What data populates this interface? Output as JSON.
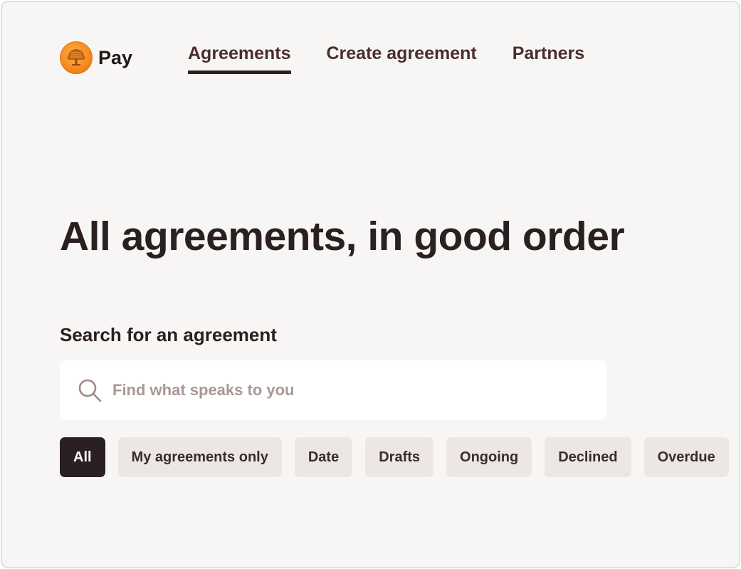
{
  "brand": {
    "name": "Pay",
    "logo_icon": "oak-tree-logo",
    "logo_color": "#f58a1f"
  },
  "nav": {
    "items": [
      {
        "label": "Agreements",
        "active": true
      },
      {
        "label": "Create agreement",
        "active": false
      },
      {
        "label": "Partners",
        "active": false
      }
    ]
  },
  "main": {
    "headline": "All agreements, in good order"
  },
  "search": {
    "label": "Search for an agreement",
    "placeholder": "Find what speaks to you",
    "value": "",
    "icon": "search-icon"
  },
  "filters": {
    "chips": [
      {
        "label": "All",
        "active": true
      },
      {
        "label": "My agreements only",
        "active": false
      },
      {
        "label": "Date",
        "active": false
      },
      {
        "label": "Drafts",
        "active": false
      },
      {
        "label": "Ongoing",
        "active": false
      },
      {
        "label": "Declined",
        "active": false
      },
      {
        "label": "Overdue",
        "active": false
      }
    ]
  },
  "colors": {
    "text": "#2b2021",
    "background": "#f8f6f4",
    "chip": "#ece7e3",
    "chip_active": "#2b2021",
    "placeholder": "#a99894"
  }
}
